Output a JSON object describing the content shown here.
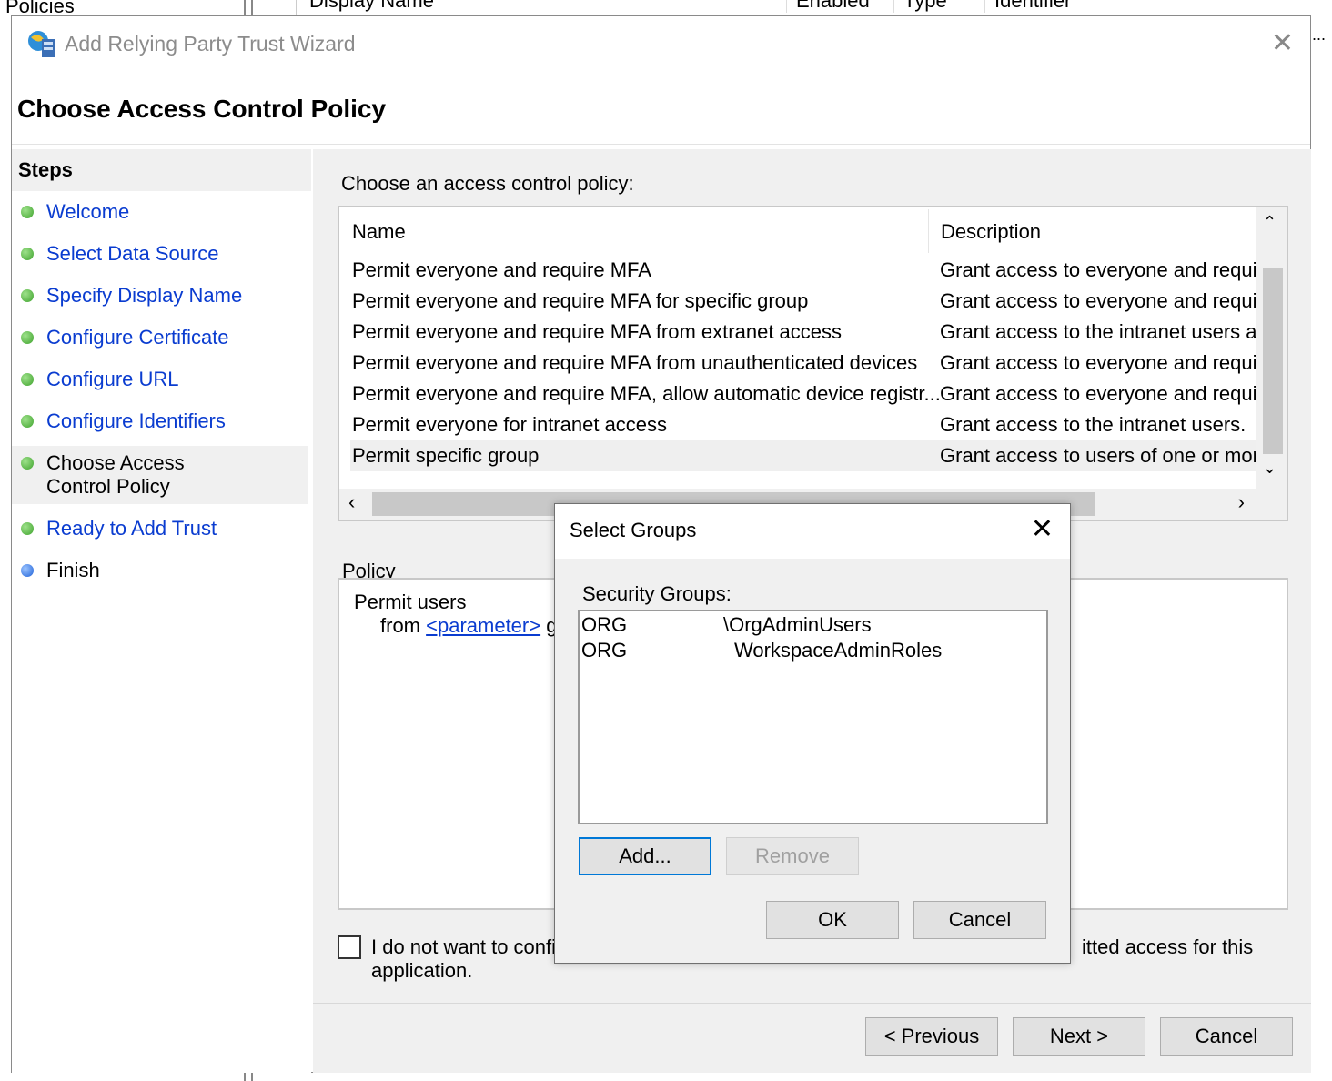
{
  "background": {
    "tree_item": "Policies",
    "columns": [
      "Display Name",
      "Enabled",
      "Type",
      "Identifier"
    ],
    "ellipsis": "..."
  },
  "wizard": {
    "title": "Add Relying Party Trust Wizard",
    "heading": "Choose Access Control Policy",
    "steps_header": "Steps",
    "steps": [
      {
        "label": "Welcome",
        "state": "done"
      },
      {
        "label": "Select Data Source",
        "state": "done"
      },
      {
        "label": "Specify Display Name",
        "state": "done"
      },
      {
        "label": "Configure Certificate",
        "state": "done"
      },
      {
        "label": "Configure URL",
        "state": "done"
      },
      {
        "label": "Configure Identifiers",
        "state": "done"
      },
      {
        "label": "Choose Access Control Policy",
        "state": "current"
      },
      {
        "label": "Ready to Add Trust",
        "state": "pending"
      },
      {
        "label": "Finish",
        "state": "pending"
      }
    ],
    "choose_label": "Choose an access control policy:",
    "table": {
      "headers": [
        "Name",
        "Description"
      ],
      "rows": [
        [
          "Permit everyone and require MFA",
          "Grant access to everyone and requir"
        ],
        [
          "Permit everyone and require MFA for specific group",
          "Grant access to everyone and requir"
        ],
        [
          "Permit everyone and require MFA from extranet access",
          "Grant access to the intranet users an"
        ],
        [
          "Permit everyone and require MFA from unauthenticated devices",
          "Grant access to everyone and requir"
        ],
        [
          "Permit everyone and require MFA, allow automatic device registr...",
          "Grant access to everyone and requir"
        ],
        [
          "Permit everyone for intranet access",
          "Grant access to the intranet users."
        ],
        [
          "Permit specific group",
          "Grant access to users of one or more"
        ]
      ],
      "selected_index": 6
    },
    "policy_label": "Policy",
    "policy_text": {
      "line1": "Permit users",
      "line2_prefix": "from",
      "parameter_link": "<parameter>",
      "line2_suffix": "g"
    },
    "checkbox": {
      "checked": false,
      "label_visible_start": "I do not want to confi",
      "label_visible_end": "itted access for this",
      "label_line2": "application."
    },
    "buttons": {
      "previous": "< Previous",
      "next": "Next >",
      "cancel": "Cancel"
    }
  },
  "select_groups": {
    "title": "Select Groups",
    "list_label": "Security Groups:",
    "groups": [
      {
        "prefix": "ORG",
        "suffix": "\\OrgAdminUsers"
      },
      {
        "prefix": "ORG",
        "suffix": "WorkspaceAdminRoles"
      }
    ],
    "buttons": {
      "add": "Add...",
      "remove": "Remove",
      "ok": "OK",
      "cancel": "Cancel"
    },
    "remove_enabled": false
  },
  "colors": {
    "link": "#0a3cd0",
    "step_done": "#3ea22c",
    "step_pending": "#1f62d8",
    "panel": "#f0f0f0",
    "focus_border": "#0078d7"
  }
}
